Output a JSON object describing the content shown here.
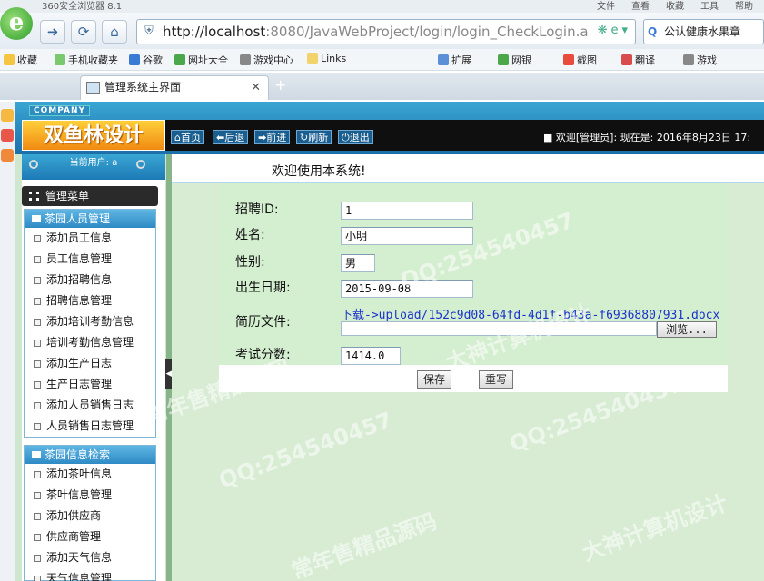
{
  "browser": {
    "app_title": "360安全浏览器 8.1",
    "menu": [
      "文件",
      "查看",
      "收藏",
      "工具",
      "帮助"
    ],
    "url_host": "http://localhost",
    "url_rest": ":8080/JavaWebProject/login/login_CheckLogin.a",
    "search_text": "公认健康水果章",
    "favorites": [
      "收藏",
      "手机收藏夹",
      "谷歌",
      "网址大全",
      "游戏中心",
      "Links",
      "扩展",
      "网银",
      "截图",
      "翻译",
      "游戏"
    ],
    "tab_title": "管理系统主界面"
  },
  "header": {
    "company": "COMPANY",
    "brand": "双鱼林设计",
    "toolbar": [
      "首页",
      "后退",
      "前进",
      "刷新",
      "退出"
    ],
    "welcome": "■ 欢迎[管理员]: 现在是: 2016年8月23日 17:"
  },
  "sidebar": {
    "current_user": "当前用户: a",
    "main_menu": "管理菜单",
    "groups": [
      {
        "title": "茶园人员管理",
        "items": [
          "添加员工信息",
          "员工信息管理",
          "添加招聘信息",
          "招聘信息管理",
          "添加培训考勤信息",
          "培训考勤信息管理",
          "添加生产日志",
          "生产日志管理",
          "添加人员销售日志",
          "人员销售日志管理"
        ]
      },
      {
        "title": "茶园信息检索",
        "items": [
          "添加茶叶信息",
          "茶叶信息管理",
          "添加供应商",
          "供应商管理",
          "添加天气信息",
          "天气信息管理"
        ]
      }
    ]
  },
  "main": {
    "welcome_title": "欢迎使用本系统!",
    "form": {
      "labels": {
        "id": "招聘ID:",
        "name": "姓名:",
        "gender": "性别:",
        "birth": "出生日期:",
        "resume": "简历文件:",
        "score": "考试分数:"
      },
      "values": {
        "id": "1",
        "name": "小明",
        "gender": "男",
        "birth": "2015-09-08",
        "resume_link": "下载->upload/152c9d08-64fd-4d1f-b43a-f69368807931.docx",
        "score": "1414.0"
      },
      "browse_label": "浏览...",
      "save_label": "保存",
      "reset_label": "重写"
    }
  },
  "watermarks": [
    "QQ:254540457",
    "大神计算机设计",
    "常年售精品源码"
  ]
}
